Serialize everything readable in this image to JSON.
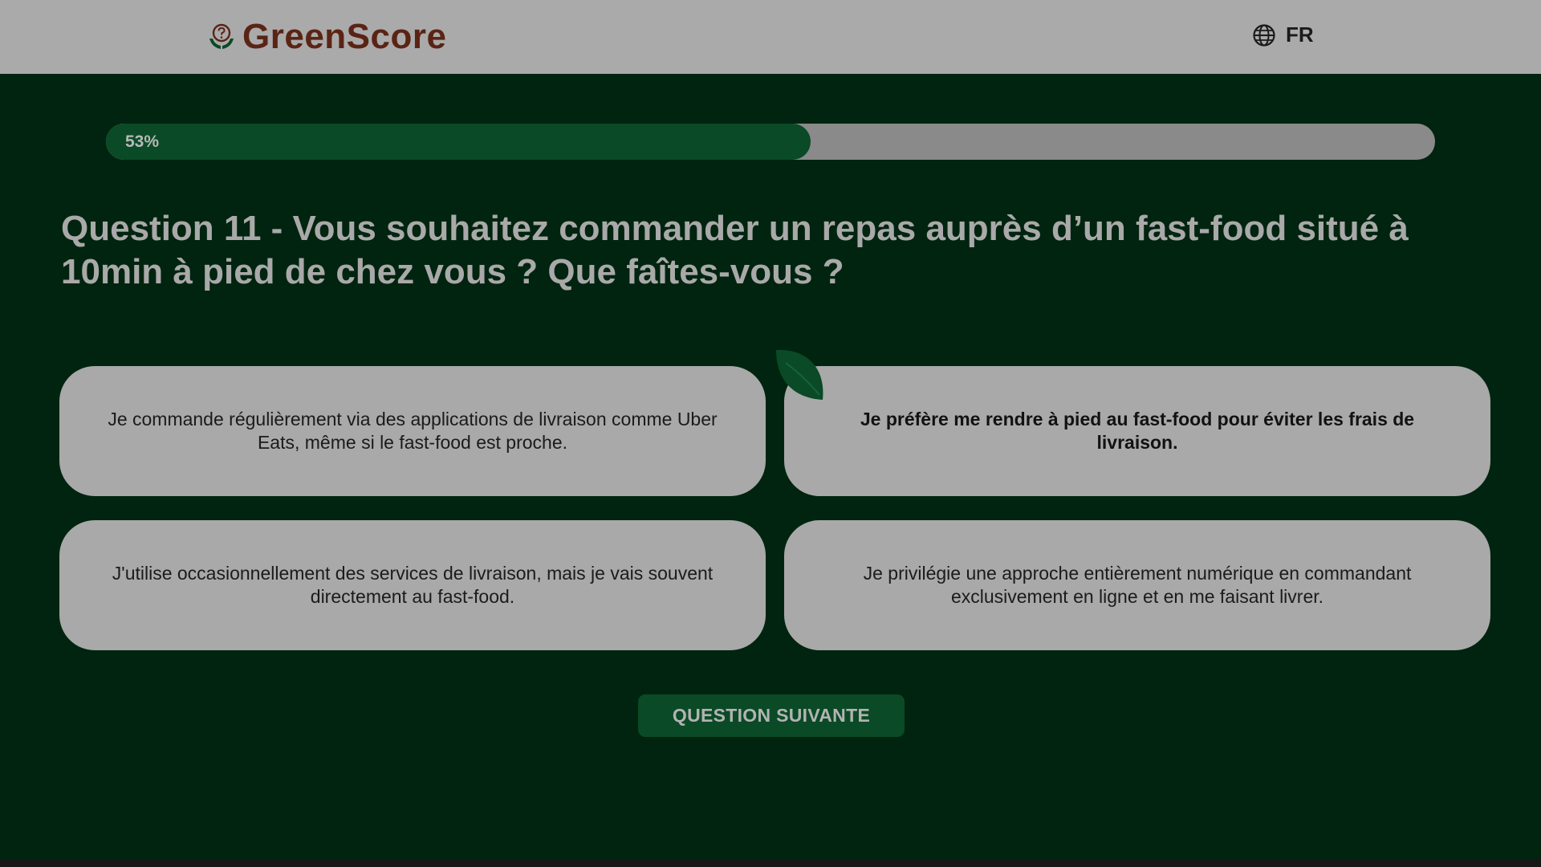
{
  "header": {
    "logo_text": "GreenScore",
    "logo_icon": "plant-in-hands-icon",
    "language_icon": "globe-icon",
    "language": "FR"
  },
  "progress": {
    "percent": 53,
    "label": "53%"
  },
  "question": {
    "text": "Question 11 - Vous souhaitez commander un repas auprès d’un fast-food situé à 10min à pied de chez vous ? Que faîtes-vous ?"
  },
  "answers": [
    {
      "text": "Je commande régulièrement via des applications de livraison comme Uber Eats, même si le fast-food est proche.",
      "selected": false
    },
    {
      "text": "Je préfère me rendre à pied au fast-food pour éviter les frais de livraison.",
      "selected": true
    },
    {
      "text": "J'utilise occasionnellement des services de livraison, mais je vais souvent directement au fast-food.",
      "selected": false
    },
    {
      "text": "Je privilégie une approche entièrement numérique en commandant exclusivement en ligne et en me faisant livrer.",
      "selected": false
    }
  ],
  "selection_marker_icon": "leaf-icon",
  "next_button": {
    "label": "QUESTION SUIVANTE"
  },
  "colors": {
    "page_background": "#00240f",
    "header_background": "#aaaaaa",
    "brand_text": "#5a2415",
    "accent_green": "#0a4a26",
    "card_background": "#a9a9a9"
  }
}
